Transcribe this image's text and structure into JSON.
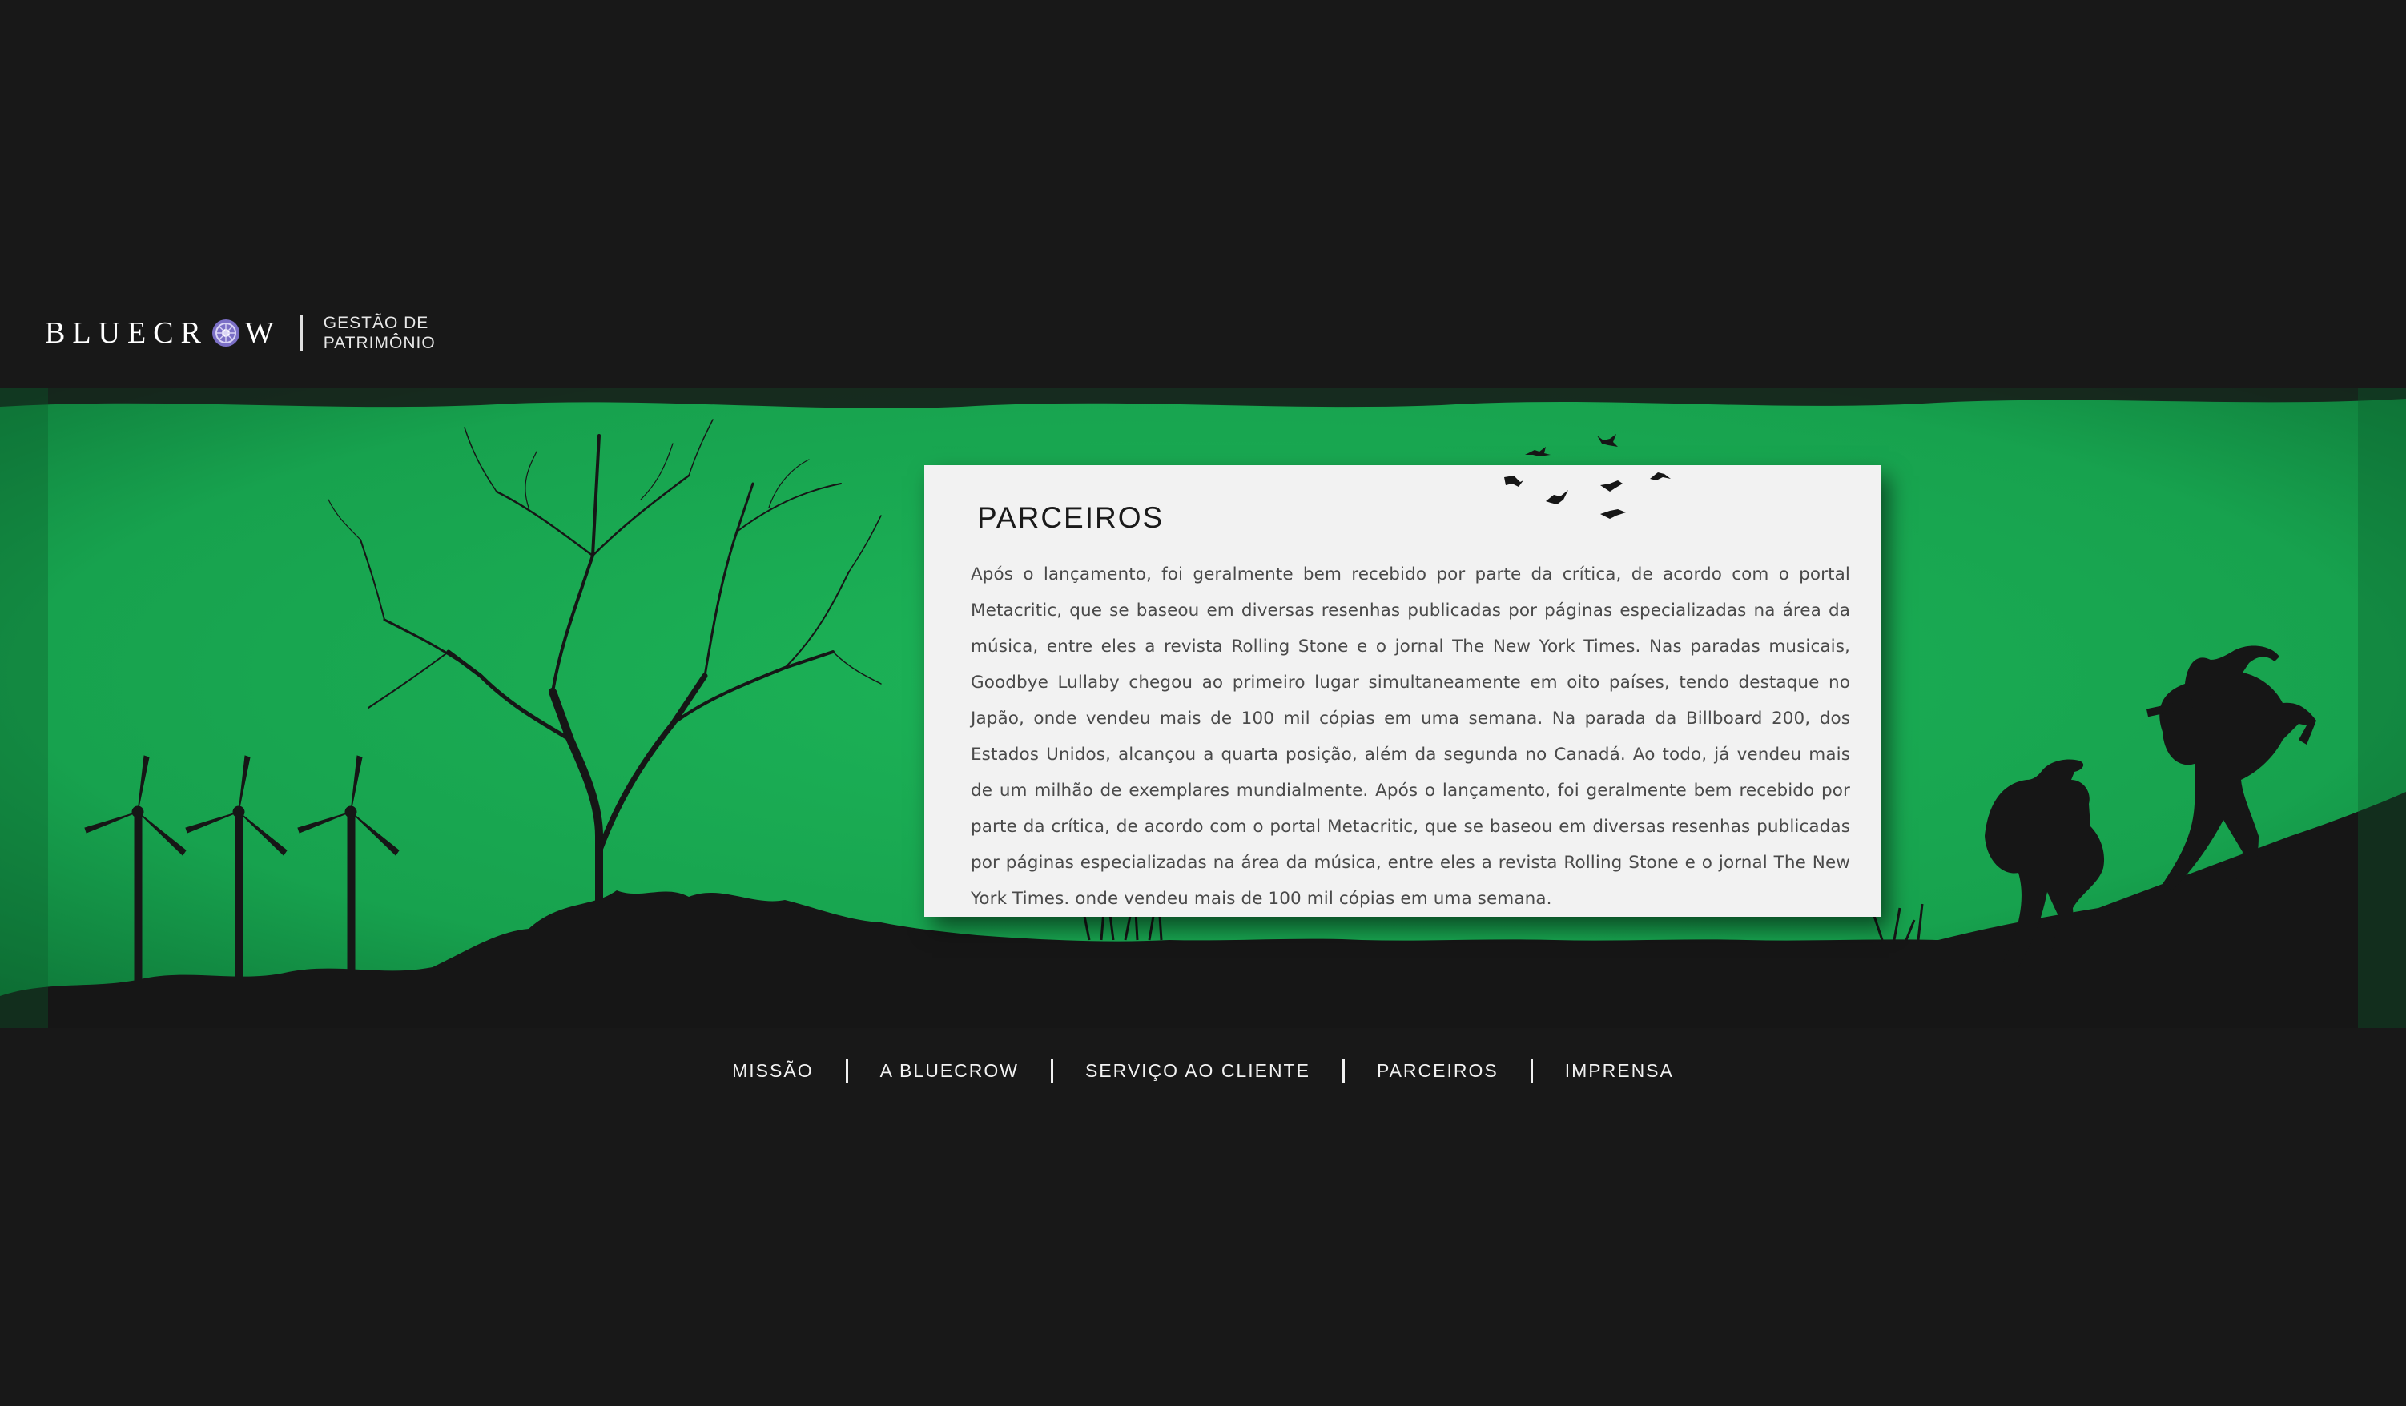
{
  "brand": {
    "name_part1": "BLUECR",
    "name_part2": "W",
    "tagline_line1": "GESTÃO DE",
    "tagline_line2": "PATRIMÔNIO",
    "accent_color": "#7b6fc6"
  },
  "hero": {
    "background_color": "#19a851",
    "silhouette_color": "#161616"
  },
  "card": {
    "title": "PARCEIROS",
    "body": "Após o lançamento, foi geralmente bem recebido por parte da crítica, de acordo com o portal Metacritic, que se baseou em diversas resenhas publicadas por páginas especializadas na área da música, entre eles a revista Rolling Stone e o jornal The New York Times. Nas paradas musicais, Goodbye Lullaby chegou ao primeiro lugar simultaneamente em oito países, tendo destaque no Japão, onde vendeu mais de 100 mil cópias em uma semana. Na parada da Billboard 200, dos Estados Unidos, alcançou a quarta posição, além da segunda no Canadá. Ao todo, já vendeu mais de um milhão de exemplares mundialmente. Após o lançamento, foi geralmente bem recebido por parte da crítica, de acordo com o portal Metacritic, que se baseou em diversas resenhas publicadas por páginas especializadas na área da música, entre eles a revista Rolling Stone e o jornal The New York Times. onde vendeu mais de 100 mil cópias em uma semana."
  },
  "nav": {
    "items": [
      {
        "label": "MISSÃO"
      },
      {
        "label": "A BLUECROW"
      },
      {
        "label": "SERVIÇO AO CLIENTE"
      },
      {
        "label": "PARCEIROS"
      },
      {
        "label": "IMPRENSA"
      }
    ]
  },
  "icons": {
    "logo_emblem": "crow-emblem-icon",
    "wind_turbine": "wind-turbine-icon",
    "tree": "bare-tree-icon",
    "birds": "flying-birds-icon",
    "hikers": "hikers-silhouette-icon"
  }
}
